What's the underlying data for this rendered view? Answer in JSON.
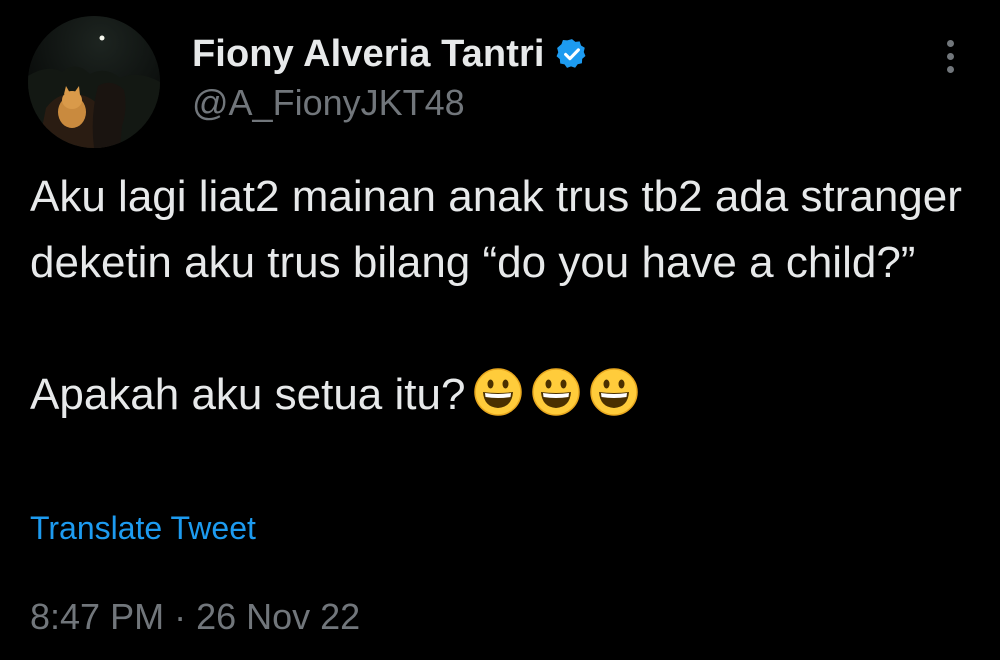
{
  "author": {
    "display_name": "Fiony Alveria Tantri",
    "handle": "@A_FionyJKT48",
    "verified": true,
    "verified_badge_color": "#1d9bf0"
  },
  "icons": {
    "avatar": "profile-photo",
    "verified": "verified-badge-icon",
    "more": "more-options-icon",
    "emoji": "grinning-face-emoji"
  },
  "tweet": {
    "paragraph_1": "Aku lagi liat2 mainan anak trus tb2 ada stranger deketin aku trus bilang “do you have a child?”",
    "paragraph_2": "Apakah aku setua itu?",
    "emoji_count": 3,
    "translate_label": "Translate Tweet",
    "time": "8:47 PM",
    "separator": "·",
    "date": "26 Nov 22"
  },
  "colors": {
    "background": "#000000",
    "text": "#e7e9ea",
    "muted": "#71767b",
    "accent": "#1d9bf0"
  }
}
